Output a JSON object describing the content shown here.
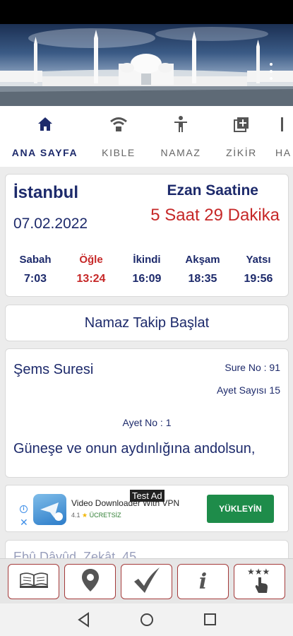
{
  "tabs": [
    {
      "label": "ANA SAYFA",
      "icon": "home-icon"
    },
    {
      "label": "KIBLE",
      "icon": "qibla-icon"
    },
    {
      "label": "NAMAZ",
      "icon": "person-icon"
    },
    {
      "label": "ZİKİR",
      "icon": "tasbih-icon"
    },
    {
      "label": "HA",
      "icon": "partial-icon"
    }
  ],
  "prayer": {
    "city": "İstanbul",
    "date": "07.02.2022",
    "ezan_title": "Ezan Saatine",
    "remaining": "5 Saat 29 Dakika",
    "times": [
      {
        "name": "Sabah",
        "time": "7:03"
      },
      {
        "name": "Öğle",
        "time": "13:24"
      },
      {
        "name": "İkindi",
        "time": "16:09"
      },
      {
        "name": "Akşam",
        "time": "18:35"
      },
      {
        "name": "Yatsı",
        "time": "19:56"
      }
    ]
  },
  "track_button_label": "Namaz Takip Başlat",
  "verse": {
    "sure_name": "Şems Suresi",
    "sure_no": "Sure No : 91",
    "ayet_count": "Ayet Sayısı 15",
    "ayet_no": "Ayet No : 1",
    "text": "Güneşe ve onun aydınlığına andolsun,"
  },
  "ad": {
    "tag": "Test Ad",
    "title": "Video Downloader With VPN",
    "rating": "4.1",
    "free_label": "ÜCRETSİZ",
    "install_label": "YÜKLEYİN"
  },
  "next_card_text": "Ebû Dâvûd, Zekât, 45",
  "colors": {
    "primary": "#1d2a6b",
    "highlight": "#c62828",
    "install": "#1e8c4a",
    "toolbar_border": "#a43a3a"
  },
  "toolbar_icons": [
    "book-icon",
    "location-pin-icon",
    "checkmark-icon",
    "info-icon",
    "rate-stars-icon"
  ],
  "nav_icons": [
    "back-icon",
    "home-circle-icon",
    "recents-icon"
  ]
}
